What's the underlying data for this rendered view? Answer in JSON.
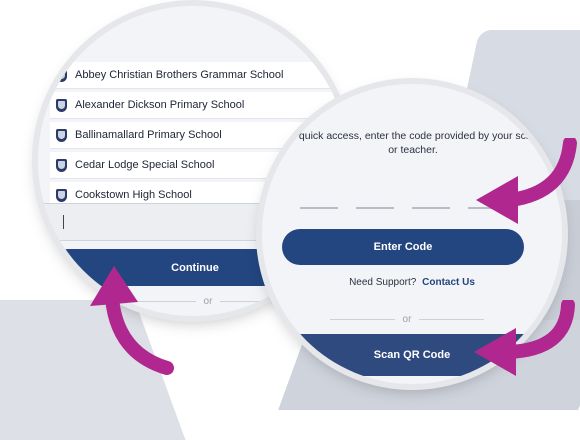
{
  "schools": [
    "Abbey Christian Brothers Grammar School",
    "Alexander Dickson Primary School",
    "Ballinamallard Primary School",
    "Cedar Lodge Special School",
    "Cookstown High School"
  ],
  "school_icon": "school-crest-icon",
  "left_panel": {
    "continue_label": "Continue",
    "or_label": "or"
  },
  "right_panel": {
    "instruction": "For quick access, enter the code provided by your school or teacher.",
    "enter_code_label": "Enter Code",
    "support_prompt": "Need Support?",
    "support_link": "Contact Us",
    "or_label": "or",
    "scan_label": "Scan QR Code"
  },
  "colors": {
    "primary": "#234680",
    "arrow": "#b0278f"
  }
}
